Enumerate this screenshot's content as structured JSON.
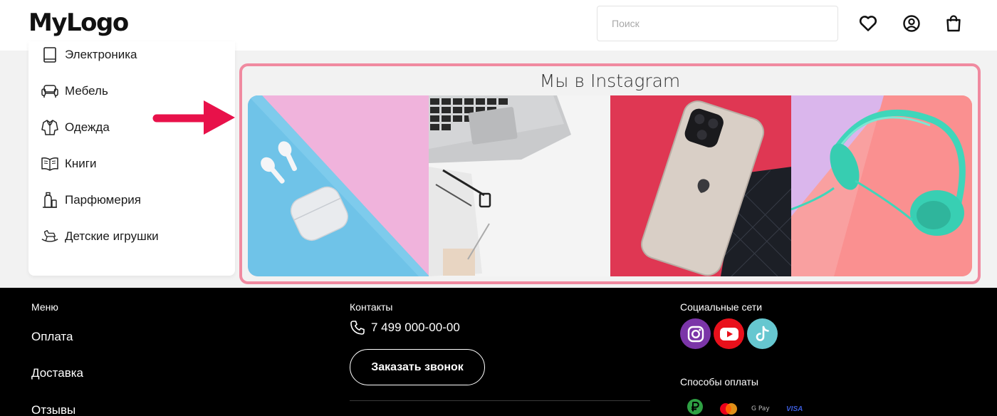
{
  "header": {
    "logo": "MyLogo",
    "search_placeholder": "Поиск",
    "icons": [
      "heart-icon",
      "user-icon",
      "bag-icon"
    ]
  },
  "sidebar": {
    "items": [
      {
        "label": "Электроника",
        "icon": "tablet-icon"
      },
      {
        "label": "Мебель",
        "icon": "sofa-icon"
      },
      {
        "label": "Одежда",
        "icon": "jacket-icon"
      },
      {
        "label": "Книги",
        "icon": "book-icon"
      },
      {
        "label": "Парфюмерия",
        "icon": "perfume-icon"
      },
      {
        "label": "Детские игрушки",
        "icon": "rocking-horse-icon"
      }
    ]
  },
  "instagram": {
    "title": "Мы в Instagram",
    "posts": [
      "airpods-photo",
      "laptop-photo",
      "iphone-photo",
      "headphones-photo"
    ]
  },
  "footer": {
    "menu": {
      "heading": "Меню",
      "links": [
        "Оплата",
        "Доставка",
        "Отзывы"
      ]
    },
    "contacts": {
      "heading": "Контакты",
      "phone": "7 499 000-00-00",
      "call_button": "Заказать звонок"
    },
    "social": {
      "heading": "Социальные сети",
      "networks": [
        "instagram-icon",
        "youtube-icon",
        "tiktok-icon"
      ]
    },
    "payment": {
      "heading": "Способы оплаты",
      "methods": [
        "ruble-icon",
        "mastercard-icon",
        "gpay-icon",
        "visa-icon"
      ],
      "gpay_label": "G Pay",
      "visa_label": "VISA"
    }
  },
  "colors": {
    "accent_border": "#f08aa0",
    "arrow": "#e8114a",
    "footer_bg": "#000000"
  }
}
